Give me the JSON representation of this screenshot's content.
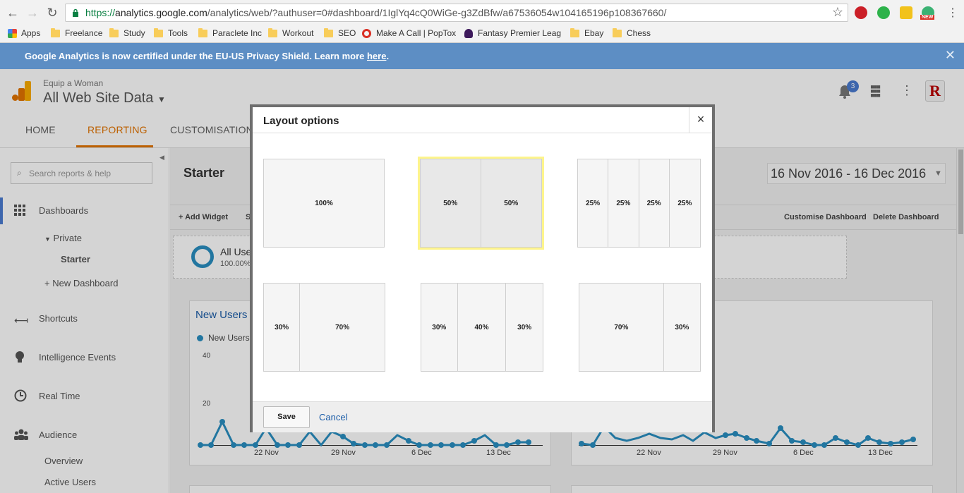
{
  "browser": {
    "url_secure": "https://",
    "url_host": "analytics.google.com",
    "url_rest": "/analytics/web/?authuser=0#dashboard/1IglYq4cQ0WiGe-g3ZdBfw/a67536054w104165196p108367660/",
    "new_badge": "NEW",
    "bookmarks": [
      "Apps",
      "Freelance",
      "Study",
      "Tools",
      "Paraclete Inc",
      "Workout",
      "SEO",
      "Make A Call | PopTox",
      "Fantasy Premier Leag",
      "Ebay",
      "Chess"
    ]
  },
  "banner": {
    "text": "Google Analytics is now certified under the EU-US Privacy Shield. Learn more ",
    "link": "here",
    "end": "."
  },
  "ga": {
    "account": "Equip a Woman",
    "property": "All Web Site Data",
    "notifications": "3",
    "tabs": [
      "HOME",
      "REPORTING",
      "CUSTOMISATION"
    ],
    "search_placeholder": "Search reports & help",
    "sidebar": {
      "dashboards": "Dashboards",
      "private": "Private",
      "starter": "Starter",
      "new_dashboard": "+ New Dashboard",
      "shortcuts": "Shortcuts",
      "intelligence": "Intelligence Events",
      "realtime": "Real Time",
      "audience": "Audience",
      "overview": "Overview",
      "active_users": "Active Users"
    },
    "dashboard_title": "Starter",
    "date_range": "16 Nov 2016 - 16 Dec 2016",
    "add_widget": "+ Add Widget",
    "share_partial": "S",
    "customise": "Customise Dashboard",
    "delete": "Delete Dashboard",
    "all_users": "All Use",
    "all_users_pct": "100.00%",
    "widget1_title": "New Users",
    "legend": "New Users",
    "y_ticks": [
      "40",
      "20"
    ],
    "x_ticks": [
      "22 Nov",
      "29 Nov",
      "6 Dec",
      "13 Dec"
    ]
  },
  "modal": {
    "title": "Layout options",
    "close": "×",
    "save": "Save",
    "cancel": "Cancel",
    "layouts": [
      {
        "cols": [
          "100%"
        ],
        "selected": false
      },
      {
        "cols": [
          "50%",
          "50%"
        ],
        "selected": true
      },
      {
        "cols": [
          "25%",
          "25%",
          "25%",
          "25%"
        ],
        "selected": false
      },
      {
        "cols": [
          "30%",
          "70%"
        ],
        "selected": false
      },
      {
        "cols": [
          "30%",
          "40%",
          "30%"
        ],
        "selected": false
      },
      {
        "cols": [
          "70%",
          "30%"
        ],
        "selected": false
      }
    ]
  },
  "colors": {
    "accent": "#e37400",
    "banner": "#5d8ec4",
    "line": "#2a8fc1",
    "selected": "#fdf48c"
  }
}
